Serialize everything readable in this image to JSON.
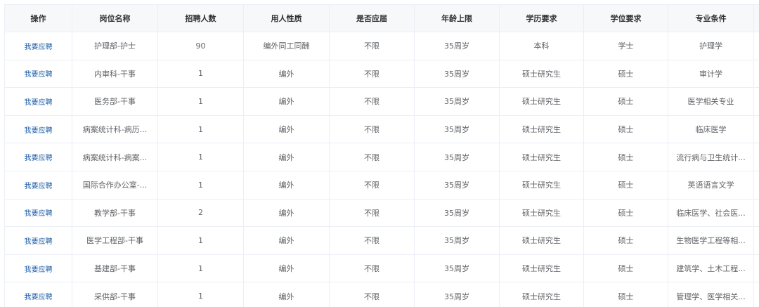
{
  "table": {
    "headers": [
      "操作",
      "岗位名称",
      "招聘人数",
      "用人性质",
      "是否应届",
      "年龄上限",
      "学历要求",
      "学位要求",
      "专业条件",
      ""
    ],
    "rows": [
      {
        "action": "我要应聘",
        "cells": [
          "护理部-护士",
          "90",
          "编外同工同酬",
          "不限",
          "35周岁",
          "本科",
          "学士",
          "护理学",
          ""
        ]
      },
      {
        "action": "我要应聘",
        "cells": [
          "内审科-干事",
          "1",
          "编外",
          "不限",
          "35周岁",
          "硕士研究生",
          "硕士",
          "审计学",
          ""
        ]
      },
      {
        "action": "我要应聘",
        "cells": [
          "医务部-干事",
          "1",
          "编外",
          "不限",
          "35周岁",
          "硕士研究生",
          "硕士",
          "医学相关专业",
          ""
        ]
      },
      {
        "action": "我要应聘",
        "cells": [
          "病案统计科-病历...",
          "1",
          "编外",
          "不限",
          "35周岁",
          "硕士研究生",
          "硕士",
          "临床医学",
          ""
        ]
      },
      {
        "action": "我要应聘",
        "cells": [
          "病案统计科-病案...",
          "1",
          "编外",
          "不限",
          "35周岁",
          "硕士研究生",
          "硕士",
          "流行病与卫生统计...",
          ""
        ]
      },
      {
        "action": "我要应聘",
        "cells": [
          "国际合作办公室-...",
          "1",
          "编外",
          "不限",
          "35周岁",
          "硕士研究生",
          "硕士",
          "英语语言文学",
          ""
        ]
      },
      {
        "action": "我要应聘",
        "cells": [
          "教学部-干事",
          "2",
          "编外",
          "不限",
          "35周岁",
          "硕士研究生",
          "硕士",
          "临床医学、社会医...",
          ""
        ]
      },
      {
        "action": "我要应聘",
        "cells": [
          "医学工程部-干事",
          "1",
          "编外",
          "不限",
          "35周岁",
          "硕士研究生",
          "硕士",
          "生物医学工程等相...",
          ""
        ]
      },
      {
        "action": "我要应聘",
        "cells": [
          "基建部-干事",
          "1",
          "编外",
          "不限",
          "35周岁",
          "硕士研究生",
          "硕士",
          "建筑学、土木工程...",
          ""
        ]
      },
      {
        "action": "我要应聘",
        "cells": [
          "采供部-干事",
          "1",
          "编外",
          "不限",
          "35周岁",
          "硕士研究生",
          "硕士",
          "管理学、医学相关...",
          ""
        ]
      }
    ]
  }
}
